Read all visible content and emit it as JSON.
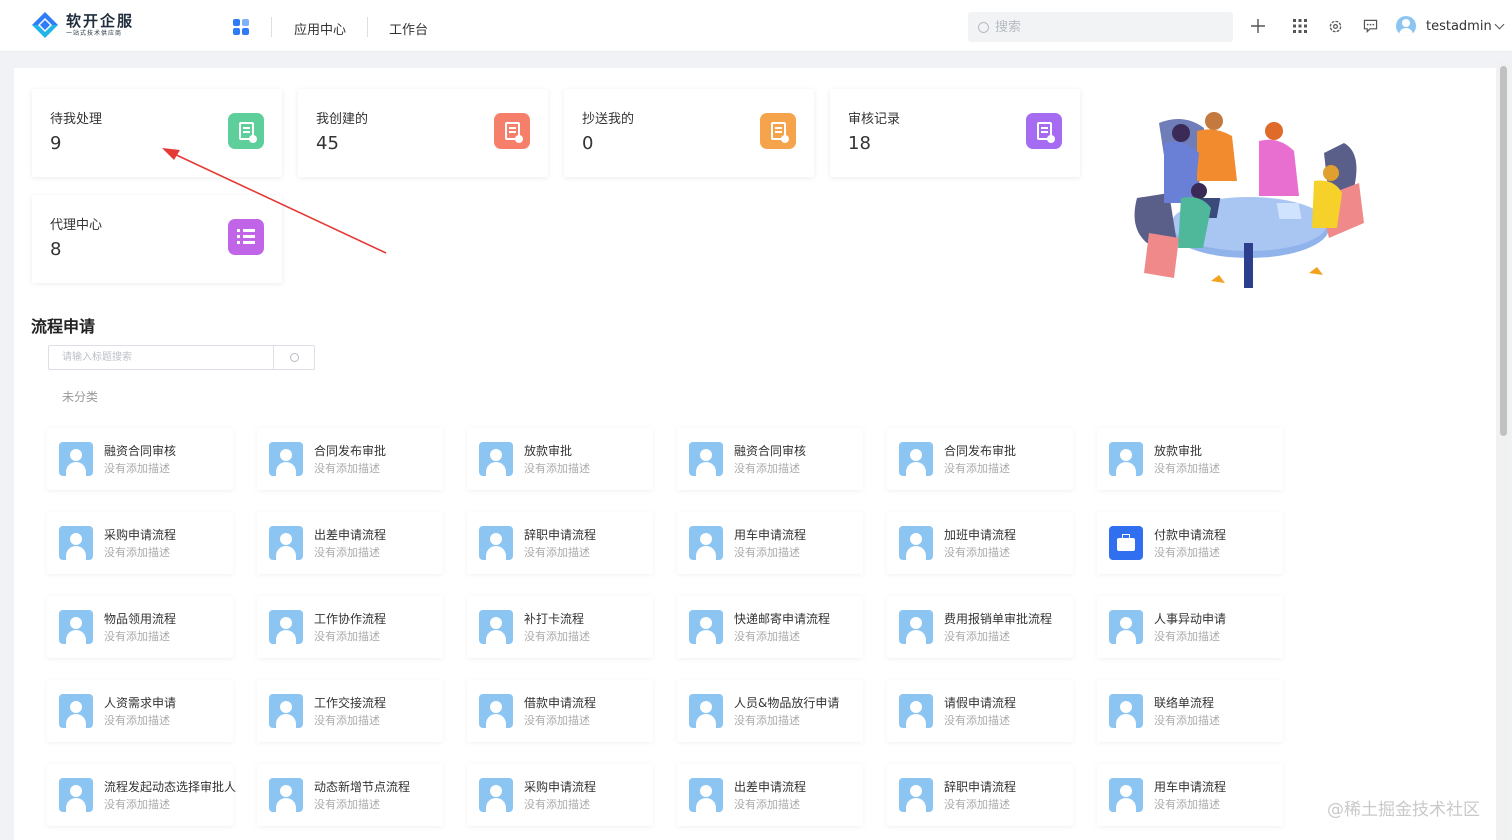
{
  "app": {
    "logo_name": "软开企服",
    "logo_sub": "一站式技术供应商"
  },
  "nav": [
    {
      "label": "应用中心"
    },
    {
      "label": "工作台"
    }
  ],
  "search": {
    "placeholder": "搜索"
  },
  "user": {
    "name": "testadmin"
  },
  "stats": [
    {
      "label": "待我处理",
      "value": "9",
      "color": "#5ecf9a"
    },
    {
      "label": "我创建的",
      "value": "45",
      "color": "#f57f6a"
    },
    {
      "label": "抄送我的",
      "value": "0",
      "color": "#f5a44c"
    },
    {
      "label": "审核记录",
      "value": "18",
      "color": "#a56cf2"
    },
    {
      "label": "代理中心",
      "value": "8",
      "color": "#c065e8"
    }
  ],
  "section": {
    "title": "流程申请",
    "filter_placeholder": "请输入标题搜索",
    "category": "未分类"
  },
  "cards": [
    {
      "title": "融资合同审核",
      "desc": "没有添加描述"
    },
    {
      "title": "合同发布审批",
      "desc": "没有添加描述"
    },
    {
      "title": "放款审批",
      "desc": "没有添加描述"
    },
    {
      "title": "融资合同审核",
      "desc": "没有添加描述"
    },
    {
      "title": "合同发布审批",
      "desc": "没有添加描述"
    },
    {
      "title": "放款审批",
      "desc": "没有添加描述"
    },
    {
      "title": "采购申请流程",
      "desc": "没有添加描述"
    },
    {
      "title": "出差申请流程",
      "desc": "没有添加描述"
    },
    {
      "title": "辞职申请流程",
      "desc": "没有添加描述"
    },
    {
      "title": "用车申请流程",
      "desc": "没有添加描述"
    },
    {
      "title": "加班申请流程",
      "desc": "没有添加描述"
    },
    {
      "title": "付款申请流程",
      "desc": "没有添加描述",
      "icon": "briefcase-icon"
    },
    {
      "title": "物品领用流程",
      "desc": "没有添加描述"
    },
    {
      "title": "工作协作流程",
      "desc": "没有添加描述"
    },
    {
      "title": "补打卡流程",
      "desc": "没有添加描述"
    },
    {
      "title": "快递邮寄申请流程",
      "desc": "没有添加描述"
    },
    {
      "title": "费用报销单审批流程",
      "desc": "没有添加描述"
    },
    {
      "title": "人事异动申请",
      "desc": "没有添加描述"
    },
    {
      "title": "人资需求申请",
      "desc": "没有添加描述"
    },
    {
      "title": "工作交接流程",
      "desc": "没有添加描述"
    },
    {
      "title": "借款申请流程",
      "desc": "没有添加描述"
    },
    {
      "title": "人员&物品放行申请",
      "desc": "没有添加描述"
    },
    {
      "title": "请假申请流程",
      "desc": "没有添加描述"
    },
    {
      "title": "联络单流程",
      "desc": "没有添加描述"
    },
    {
      "title": "流程发起动态选择审批人",
      "desc": "没有添加描述"
    },
    {
      "title": "动态新增节点流程",
      "desc": "没有添加描述"
    },
    {
      "title": "采购申请流程",
      "desc": "没有添加描述"
    },
    {
      "title": "出差申请流程",
      "desc": "没有添加描述"
    },
    {
      "title": "辞职申请流程",
      "desc": "没有添加描述"
    },
    {
      "title": "用车申请流程",
      "desc": "没有添加描述"
    }
  ],
  "watermark": "@稀土掘金技术社区"
}
